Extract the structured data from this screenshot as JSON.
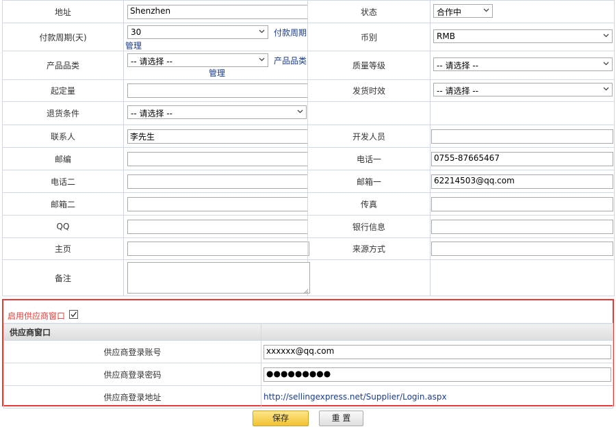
{
  "form": {
    "address": {
      "label": "地址",
      "value": "Shenzhen"
    },
    "status": {
      "label": "状态",
      "value": "合作中"
    },
    "payment_cycle": {
      "label": "付款周期(天)",
      "value": "30",
      "link_1": "付款周期",
      "link_2": "管理"
    },
    "currency": {
      "label": "币别",
      "value": "RMB"
    },
    "product_category": {
      "label": "产品品类",
      "value": "-- 请选择 --",
      "link_1": "产品品类",
      "link_2": "管理"
    },
    "quality_grade": {
      "label": "质量等级",
      "value": "-- 请选择 --"
    },
    "moq": {
      "label": "起定量",
      "value": ""
    },
    "delivery_time": {
      "label": "发货时效",
      "value": "-- 请选择 --"
    },
    "return_terms": {
      "label": "退货条件",
      "value": "-- 请选择 --"
    },
    "contact": {
      "label": "联系人",
      "value": "李先生"
    },
    "developer": {
      "label": "开发人员",
      "value": ""
    },
    "postcode": {
      "label": "邮编",
      "value": ""
    },
    "phone1": {
      "label": "电话一",
      "value": "0755-87665467"
    },
    "phone2": {
      "label": "电话二",
      "value": ""
    },
    "email1": {
      "label": "邮箱一",
      "value": "62214503@qq.com"
    },
    "email2": {
      "label": "邮箱二",
      "value": ""
    },
    "fax": {
      "label": "传真",
      "value": ""
    },
    "qq": {
      "label": "QQ",
      "value": ""
    },
    "bank_info": {
      "label": "银行信息",
      "value": ""
    },
    "homepage": {
      "label": "主页",
      "value": ""
    },
    "source": {
      "label": "来源方式",
      "value": ""
    },
    "remark": {
      "label": "备注",
      "value": ""
    }
  },
  "supplier_window": {
    "enable_label": "启用供应商窗口",
    "enabled": true,
    "header": "供应商窗口",
    "account_label": "供应商登录账号",
    "account_value": "xxxxxx@qq.com",
    "password_label": "供应商登录密码",
    "password_value": "●●●●●●●●●",
    "url_label": "供应商登录地址",
    "url_value": "http://sellingexpress.net/Supplier/Login.aspx"
  },
  "buttons": {
    "save": "保存",
    "reset": "重 置"
  },
  "colors": {
    "accent_red": "#e53935",
    "link_blue": "#1a3c8c",
    "save_yellow": "#f1c232"
  }
}
